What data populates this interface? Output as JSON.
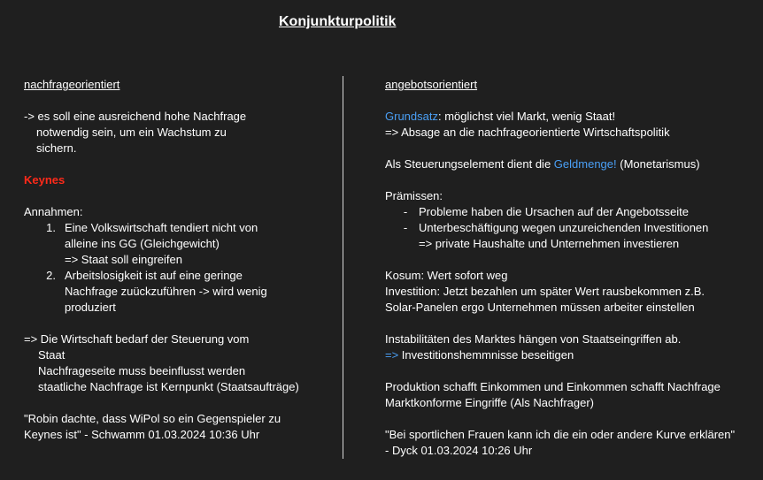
{
  "title": "Konjunkturpolitik",
  "left": {
    "heading": "nachfrageorientiert",
    "intro": [
      "-> es soll eine ausreichend hohe Nachfrage",
      "notwendig sein, um ein Wachstum zu",
      "sichern."
    ],
    "keynes": "Keynes",
    "annahmen_label": "Annahmen:",
    "annahmen": [
      {
        "num": "1.",
        "lines": [
          "Eine Volkswirtschaft tendiert nicht von",
          "alleine ins GG (Gleichgewicht)",
          "=> Staat soll eingreifen"
        ]
      },
      {
        "num": "2.",
        "lines": [
          "Arbeitslosigkeit ist auf eine geringe",
          "Nachfrage zuückzuführen -> wird wenig",
          "produziert"
        ]
      }
    ],
    "conclusion": [
      "=> Die Wirtschaft bedarf der Steuerung vom",
      "Staat",
      "Nachfrageseite muss beeinflusst werden",
      "staatliche Nachfrage ist Kernpunkt (Staatsaufträge)"
    ],
    "quote": [
      "\"Robin dachte, dass WiPol so ein Gegenspieler zu",
      "Keynes ist\" - Schwamm 01.03.2024 10:36 Uhr"
    ]
  },
  "right": {
    "heading": "angebotsorientiert",
    "grundsatz_key": "Grundsatz",
    "grundsatz_rest": ": möglichst viel Markt, wenig Staat!",
    "absage": "=> Absage an die nachfrageorientierte Wirtschaftspolitik",
    "steuer_pre": "Als Steuerungselement dient die ",
    "steuer_key": "Geldmenge!",
    "steuer_post": " (Monetarismus)",
    "praemissen_label": "Prämissen:",
    "praemissen": [
      {
        "dash": "-",
        "lines": [
          "Probleme haben die Ursachen auf der Angebotsseite"
        ]
      },
      {
        "dash": "-",
        "lines": [
          "Unterbeschäftigung wegen unzureichenden Investitionen",
          "=> private Haushalte und Unternehmen investieren"
        ]
      }
    ],
    "konsum": [
      "Kosum: Wert sofort weg",
      "Investition: Jetzt bezahlen um später Wert rausbekommen z.B.",
      "Solar-Panelen ergo Unternehmen müssen arbeiter einstellen"
    ],
    "instab": "Instabilitäten des Marktes hängen von Staatseingriffen ab.",
    "arrow": "=>",
    "hemm": " Investitionshemmnisse beseitigen",
    "produktion": [
      "Produktion schafft Einkommen und Einkommen schafft Nachfrage",
      "Marktkonforme Eingriffe (Als Nachfrager)"
    ],
    "quote": [
      "\"Bei sportlichen Frauen kann ich die ein oder andere Kurve erklären\"",
      "- Dyck 01.03.2024 10:26 Uhr"
    ]
  }
}
